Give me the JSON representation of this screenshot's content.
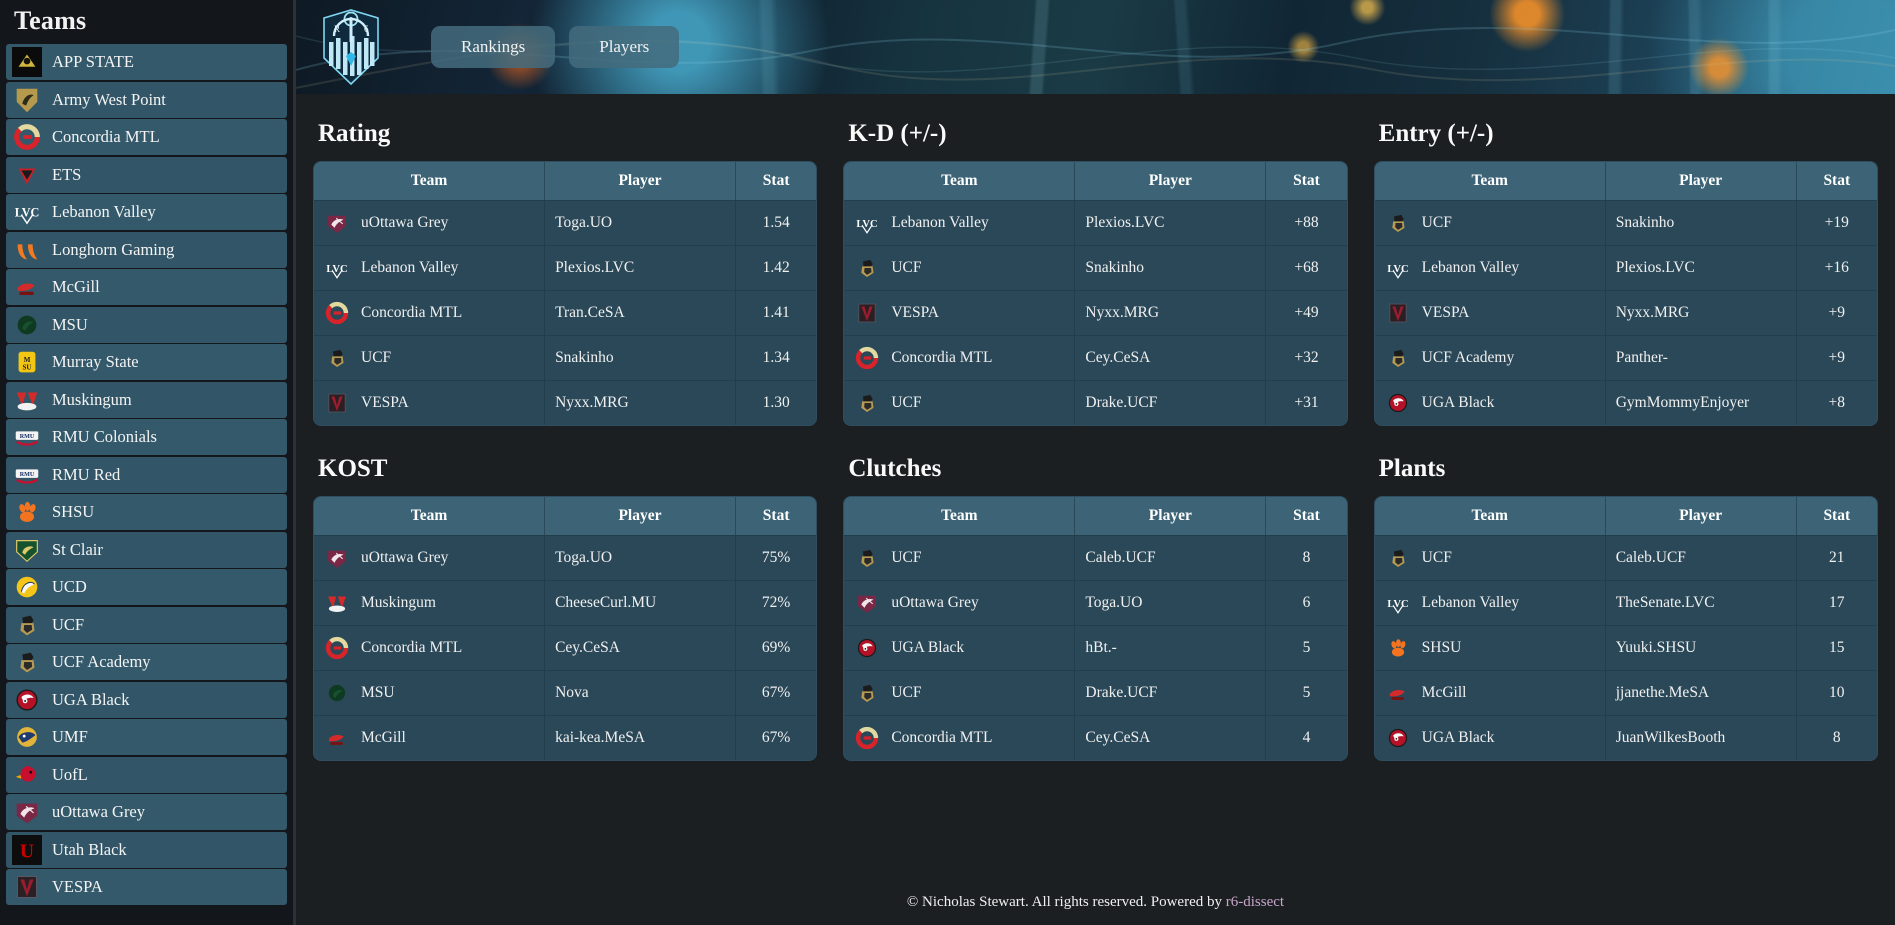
{
  "sidebar": {
    "title": "Teams",
    "teams": [
      {
        "name": "APP STATE",
        "logo": "appstate"
      },
      {
        "name": "Army West Point",
        "logo": "army"
      },
      {
        "name": "Concordia MTL",
        "logo": "concordia"
      },
      {
        "name": "ETS",
        "logo": "ets"
      },
      {
        "name": "Lebanon Valley",
        "logo": "lvc"
      },
      {
        "name": "Longhorn Gaming",
        "logo": "longhorn"
      },
      {
        "name": "McGill",
        "logo": "mcgill"
      },
      {
        "name": "MSU",
        "logo": "msu"
      },
      {
        "name": "Murray State",
        "logo": "murray"
      },
      {
        "name": "Muskingum",
        "logo": "muskingum"
      },
      {
        "name": "RMU Colonials",
        "logo": "rmu"
      },
      {
        "name": "RMU Red",
        "logo": "rmu"
      },
      {
        "name": "SHSU",
        "logo": "shsu"
      },
      {
        "name": "St Clair",
        "logo": "stclair"
      },
      {
        "name": "UCD",
        "logo": "ucd"
      },
      {
        "name": "UCF",
        "logo": "ucf"
      },
      {
        "name": "UCF Academy",
        "logo": "ucf"
      },
      {
        "name": "UGA Black",
        "logo": "uga"
      },
      {
        "name": "UMF",
        "logo": "umf"
      },
      {
        "name": "UofL",
        "logo": "uofl"
      },
      {
        "name": "uOttawa Grey",
        "logo": "uottawa"
      },
      {
        "name": "Utah Black",
        "logo": "utah"
      },
      {
        "name": "VESPA",
        "logo": "vespa"
      }
    ]
  },
  "header": {
    "logo_name": "r6-shield-logo",
    "tabs": [
      {
        "label": "Rankings",
        "active": true
      },
      {
        "label": "Players",
        "active": false
      }
    ]
  },
  "columns": [
    "Team",
    "Player",
    "Stat"
  ],
  "panels": [
    {
      "title": "Rating",
      "rows": [
        {
          "logo": "uottawa",
          "team": "uOttawa Grey",
          "player": "Toga.UO",
          "stat": "1.54"
        },
        {
          "logo": "lvc",
          "team": "Lebanon Valley",
          "player": "Plexios.LVC",
          "stat": "1.42"
        },
        {
          "logo": "concordia",
          "team": "Concordia MTL",
          "player": "Tran.CeSA",
          "stat": "1.41"
        },
        {
          "logo": "ucf",
          "team": "UCF",
          "player": "Snakinho",
          "stat": "1.34"
        },
        {
          "logo": "vespa",
          "team": "VESPA",
          "player": "Nyxx.MRG",
          "stat": "1.30"
        }
      ]
    },
    {
      "title": "K-D (+/-)",
      "rows": [
        {
          "logo": "lvc",
          "team": "Lebanon Valley",
          "player": "Plexios.LVC",
          "stat": "+88"
        },
        {
          "logo": "ucf",
          "team": "UCF",
          "player": "Snakinho",
          "stat": "+68"
        },
        {
          "logo": "vespa",
          "team": "VESPA",
          "player": "Nyxx.MRG",
          "stat": "+49"
        },
        {
          "logo": "concordia",
          "team": "Concordia MTL",
          "player": "Cey.CeSA",
          "stat": "+32"
        },
        {
          "logo": "ucf",
          "team": "UCF",
          "player": "Drake.UCF",
          "stat": "+31"
        }
      ]
    },
    {
      "title": "Entry (+/-)",
      "rows": [
        {
          "logo": "ucf",
          "team": "UCF",
          "player": "Snakinho",
          "stat": "+19"
        },
        {
          "logo": "lvc",
          "team": "Lebanon Valley",
          "player": "Plexios.LVC",
          "stat": "+16"
        },
        {
          "logo": "vespa",
          "team": "VESPA",
          "player": "Nyxx.MRG",
          "stat": "+9"
        },
        {
          "logo": "ucf",
          "team": "UCF Academy",
          "player": "Panther-",
          "stat": "+9"
        },
        {
          "logo": "uga",
          "team": "UGA Black",
          "player": "GymMommyEnjoyer",
          "stat": "+8"
        }
      ]
    },
    {
      "title": "KOST",
      "rows": [
        {
          "logo": "uottawa",
          "team": "uOttawa Grey",
          "player": "Toga.UO",
          "stat": "75%"
        },
        {
          "logo": "muskingum",
          "team": "Muskingum",
          "player": "CheeseCurl.MU",
          "stat": "72%"
        },
        {
          "logo": "concordia",
          "team": "Concordia MTL",
          "player": "Cey.CeSA",
          "stat": "69%"
        },
        {
          "logo": "msu",
          "team": "MSU",
          "player": "Nova",
          "stat": "67%"
        },
        {
          "logo": "mcgill",
          "team": "McGill",
          "player": "kai-kea.MeSA",
          "stat": "67%"
        }
      ]
    },
    {
      "title": "Clutches",
      "rows": [
        {
          "logo": "ucf",
          "team": "UCF",
          "player": "Caleb.UCF",
          "stat": "8"
        },
        {
          "logo": "uottawa",
          "team": "uOttawa Grey",
          "player": "Toga.UO",
          "stat": "6"
        },
        {
          "logo": "uga",
          "team": "UGA Black",
          "player": "hBt.-",
          "stat": "5"
        },
        {
          "logo": "ucf",
          "team": "UCF",
          "player": "Drake.UCF",
          "stat": "5"
        },
        {
          "logo": "concordia",
          "team": "Concordia MTL",
          "player": "Cey.CeSA",
          "stat": "4"
        }
      ]
    },
    {
      "title": "Plants",
      "rows": [
        {
          "logo": "ucf",
          "team": "UCF",
          "player": "Caleb.UCF",
          "stat": "21"
        },
        {
          "logo": "lvc",
          "team": "Lebanon Valley",
          "player": "TheSenate.LVC",
          "stat": "17"
        },
        {
          "logo": "shsu",
          "team": "SHSU",
          "player": "Yuuki.SHSU",
          "stat": "15"
        },
        {
          "logo": "mcgill",
          "team": "McGill",
          "player": "jjanethe.MeSA",
          "stat": "10"
        },
        {
          "logo": "uga",
          "team": "UGA Black",
          "player": "JuanWilkesBooth",
          "stat": "8"
        }
      ]
    }
  ],
  "footer": {
    "text": "© Nicholas Stewart. All rights reserved. Powered by ",
    "link_label": "r6-dissect"
  },
  "colors": {
    "sidebar_bg": "#13171b",
    "sidebar_item": "#33596b",
    "main_bg": "#1b1f22",
    "table_header": "#3c6476",
    "table_row": "#2a4858",
    "text": "#f2f2f2",
    "link": "#c8a5c9"
  }
}
